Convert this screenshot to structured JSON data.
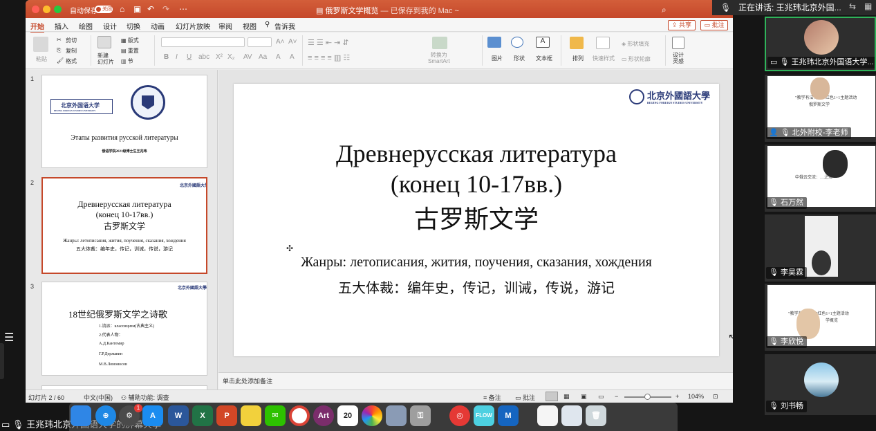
{
  "titlebar": {
    "autosave_label": "自动保存",
    "autosave_state": "关闭",
    "doc_name": "俄罗斯文学概览",
    "saved_status": " — 已保存到我的 Mac ~"
  },
  "menu": {
    "items": [
      "开始",
      "插入",
      "绘图",
      "设计",
      "切换",
      "动画",
      "幻灯片放映",
      "审阅",
      "视图",
      "告诉我"
    ],
    "share": "共享",
    "comment": "批注"
  },
  "ribbon": {
    "paste": "粘贴",
    "cut": "剪切",
    "copy": "复制",
    "format": "格式",
    "new_slide": "新建\n幻灯片",
    "layout": "版式",
    "reset": "重置",
    "section": "节",
    "convert_smartart": "转换为\nSmartArt",
    "picture": "图片",
    "shape": "形状",
    "textbox": "文本框",
    "arrange": "排列",
    "quick_styles": "快速样式",
    "shape_fill": "形状填充",
    "shape_outline": "形状轮廓",
    "design_ideas": "设计\n灵感"
  },
  "thumbnails": [
    {
      "num": "1",
      "bfsu": "北京外国语大学",
      "bfsu_en": "BEIJING FOREIGN STUDIES UNIVERSITY",
      "title": "Этапы развития русской литературы",
      "subtitle": "俄语学院2021级博士生王兆玮"
    },
    {
      "num": "2",
      "bfsu": "北京外國語大學",
      "line1": "Древнерусская литература",
      "line2": "(конец 10-17вв.)",
      "line3": "古罗斯文学",
      "genres": "Жанры: летописания, жития, поучения, сказания, хождения",
      "genres_zh": "五大体裁：编年史，传记，训诫，传说，游记"
    },
    {
      "num": "3",
      "bfsu": "北京外國語大學",
      "title": "18世纪俄罗斯文学之诗歌",
      "item1": "1.流派：классицизм(古典主义)",
      "item2": "2.代表人物：",
      "poet1": "А.Д.Кантемир",
      "poet2": "Г.Р.Державин",
      "poet3": "М.В.Ломоносов"
    }
  ],
  "slide": {
    "bfsu": "北京外國語大學",
    "bfsu_en": "BEIJING FOREIGN STUDIES UNIVERSITY",
    "line1": "Древнерусская литература",
    "line2": "(конец 10-17вв.)",
    "line3": "古罗斯文学",
    "genres": "Жанры: летописания, жития, поучения, сказания, хождения",
    "genres_zh": "五大体裁：编年史，传记，训诫，传说，游记"
  },
  "notes_placeholder": "单击此处添加备注",
  "status": {
    "slide_count": "幻灯片 2 / 60",
    "language": "中文(中国)",
    "accessibility": "辅助功能: 调查",
    "notes": "备注",
    "comments": "批注",
    "zoom": "104%"
  },
  "dock": {
    "calendar_day": "20",
    "badge": "1",
    "apps": [
      "finder",
      "safari",
      "launchpad",
      "app-store",
      "word",
      "excel",
      "powerpoint",
      "lemon",
      "wechat",
      "chrome",
      "art",
      "calendar",
      "photos",
      "preview",
      "keychain",
      "netease-music",
      "flowvpn",
      "tencent-meeting",
      "docs",
      "screenshot",
      "trash"
    ]
  },
  "meeting": {
    "speaking_now": "正在讲话: 王兆玮北京外国...",
    "share_label": "王兆玮北京外国语大学的屏幕共享",
    "participants": [
      {
        "name": "王兆玮北京外国语大学..."
      },
      {
        "name": "北外附校-李老师"
      },
      {
        "name": "石万然"
      },
      {
        "name": "李昊霖"
      },
      {
        "name": "李欣悦"
      },
      {
        "name": "刘书畅"
      }
    ],
    "tile_slide_text_a": "\"教学有法 珍存\"  红色1+1主题活动",
    "tile_slide_text_b": "俄罗斯文学",
    "tile_slide_text_c": "中俄云交流：…之治",
    "tile_slide_text_d": "\"教学有法 ……\"红色1+1主题活动",
    "tile_slide_text_e": "学概览"
  },
  "colors": {
    "accent": "#c5482a",
    "speaker_border": "#2fb35a",
    "bfsu_blue": "#2a3a78"
  }
}
